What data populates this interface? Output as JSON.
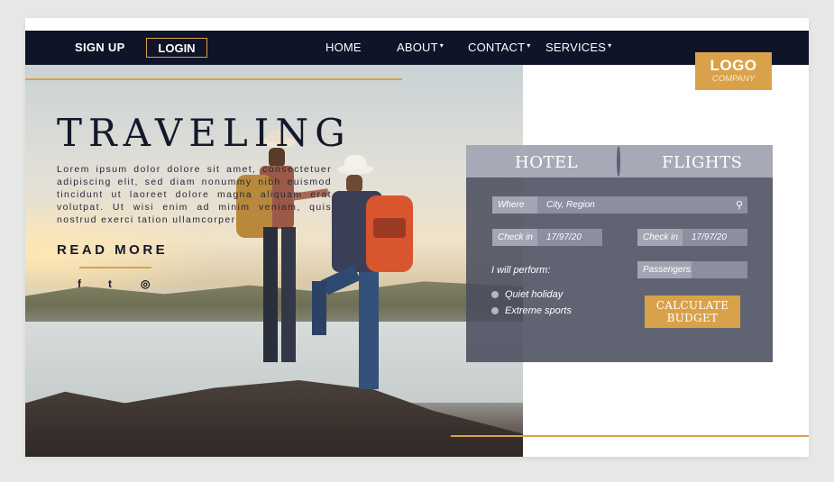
{
  "nav": {
    "signup": "SIGN UP",
    "login": "LOGIN",
    "items": [
      {
        "label": "HOME",
        "has_dropdown": false
      },
      {
        "label": "ABOUT",
        "has_dropdown": true
      },
      {
        "label": "CONTACT",
        "has_dropdown": true
      },
      {
        "label": "SERVICES",
        "has_dropdown": true
      }
    ],
    "caret": "▾"
  },
  "logo": {
    "name": "LOGO",
    "tagline": "COMPANY"
  },
  "hero": {
    "title": "TRAVELING",
    "body": "Lorem ipsum dolor dolore sit amet, consectetuer adipiscing elit, sed diam nonummy nibh euismod tincidunt ut laoreet dolore magna aliquam erat volutpat. Ut wisi enim ad minim veniam, quis nostrud exerci tation ullamcorper",
    "cta": "READ MORE",
    "social": [
      {
        "icon": "facebook-icon",
        "glyph": "f"
      },
      {
        "icon": "twitter-icon",
        "glyph": "t"
      },
      {
        "icon": "instagram-icon",
        "glyph": "◎"
      }
    ]
  },
  "booking": {
    "tabs": [
      "HOTEL",
      "FLIGHTS"
    ],
    "where_label": "Where",
    "where_value": "City, Region",
    "checkin1_label": "Check in",
    "checkin1_value": "17/97/20",
    "checkin2_label": "Check in",
    "checkin2_value": "17/97/20",
    "perform_label": "I will perform:",
    "options": [
      "Quiet holiday",
      "Extreme sports"
    ],
    "passengers_label": "Passengers:",
    "passengers_value": "",
    "calc_button": "CALCULATE BUDGET"
  },
  "colors": {
    "navy": "#0f1428",
    "gold": "#d9a24a",
    "panel": "#4a4d5e",
    "tab_bar": "#a7a9b7"
  }
}
